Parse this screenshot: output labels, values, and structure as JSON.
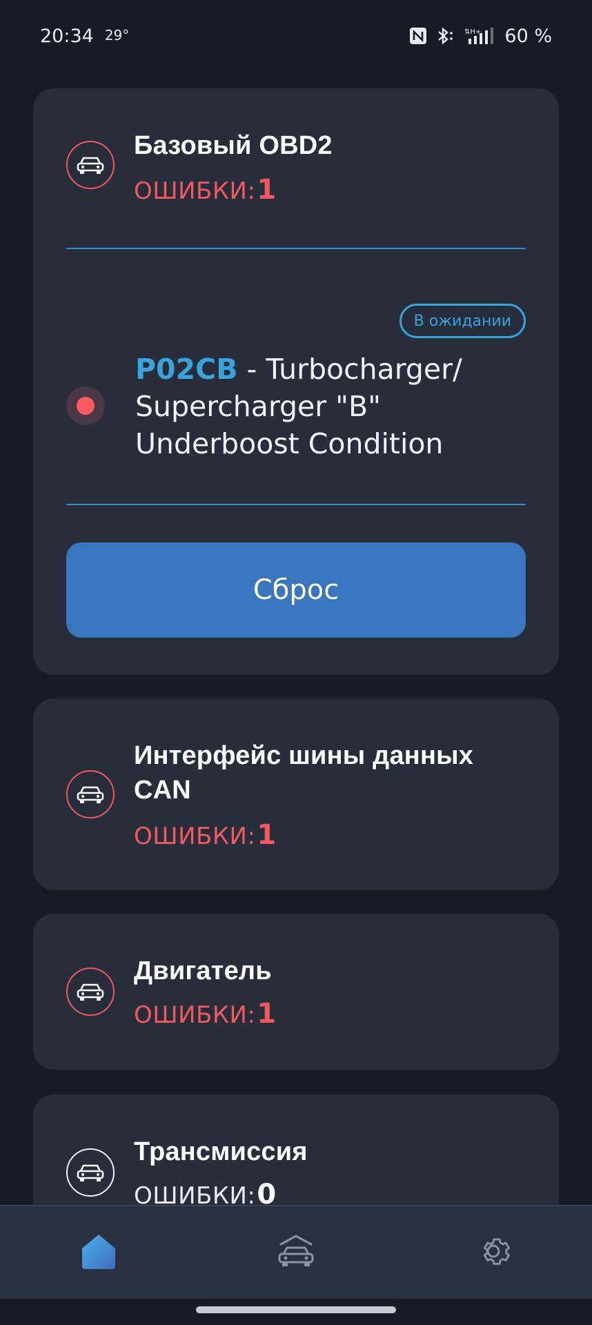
{
  "status_bar": {
    "time": "20:34",
    "temperature": "29°",
    "battery": "60 %",
    "icons": [
      "nfc-icon",
      "bluetooth-icon",
      "signal-icon"
    ]
  },
  "cards": [
    {
      "title": "Базовый OBD2",
      "errors_label": "ОШИБКИ:",
      "errors_count": "1",
      "status_badge": "В ожидании",
      "dtc_code": "P02CB",
      "dtc_description": " - Turbocharger/ Supercharger \"B\" Underboost Condition",
      "reset_label": "Сброс"
    },
    {
      "title": "Интерфейс шины данных CAN",
      "errors_label": "ОШИБКИ:",
      "errors_count": "1"
    },
    {
      "title": "Двигатель",
      "errors_label": "ОШИБКИ:",
      "errors_count": "1"
    },
    {
      "title": "Трансмиссия",
      "errors_label": "ОШИБКИ:",
      "errors_count": "0"
    }
  ],
  "bottom_nav": {
    "items": [
      "home-icon",
      "car-icon",
      "settings-icon"
    ],
    "active": "home-icon"
  },
  "colors": {
    "background": "#171b26",
    "card": "#272d3b",
    "error": "#f05a5f",
    "accent": "#3aa3dc",
    "button": "#3a75c0"
  }
}
